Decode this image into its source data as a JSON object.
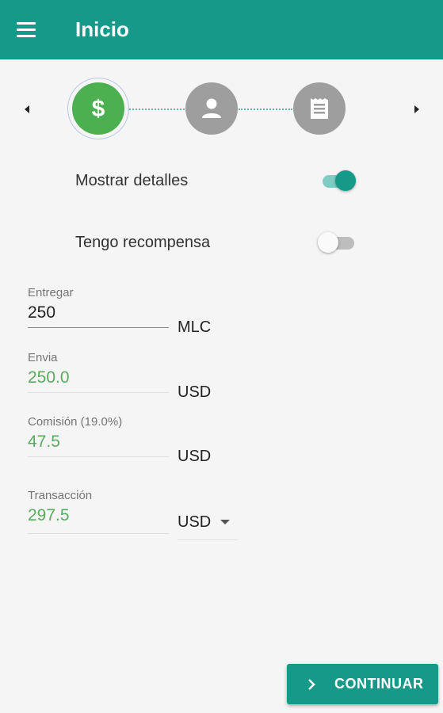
{
  "app": {
    "title": "Inicio",
    "colors": {
      "primary": "#17998a",
      "step_active": "#4caf50",
      "step_inactive": "#9e9e9e",
      "calculated_value": "#5aab5f"
    }
  },
  "stepper": {
    "steps": [
      {
        "icon": "dollar-icon",
        "state": "active"
      },
      {
        "icon": "person-icon",
        "state": "inactive"
      },
      {
        "icon": "receipt-icon",
        "state": "inactive"
      }
    ],
    "prev_icon": "arrow-left-icon",
    "next_icon": "arrow-right-icon"
  },
  "toggles": {
    "details": {
      "label": "Mostrar detalles",
      "on": true
    },
    "reward": {
      "label": "Tengo recompensa",
      "on": false
    }
  },
  "form": {
    "entregar": {
      "label": "Entregar",
      "value": "250",
      "unit": "MLC"
    },
    "envia": {
      "label": "Envia",
      "value": "250.0",
      "unit": "USD"
    },
    "comision": {
      "label": "Comisión (19.0%)",
      "value": "47.5",
      "unit": "USD"
    },
    "transaccion": {
      "label": "Transacción",
      "value": "297.5",
      "currency": "USD"
    }
  },
  "actions": {
    "continue_label": "CONTINUAR",
    "continue_icon": "chevron-right-icon"
  }
}
